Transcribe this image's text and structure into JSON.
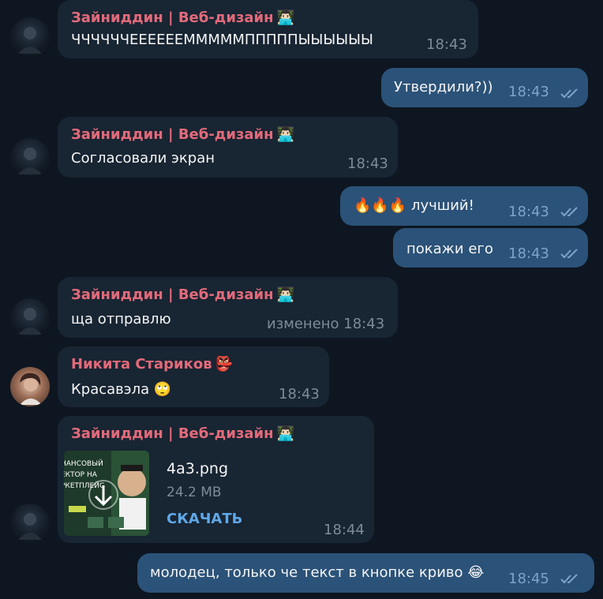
{
  "messages": [
    {
      "sender": "Зайниддин | Веб-дизайн",
      "sender_emoji": "👨🏻‍💻",
      "text": "ЧЧЧЧЧЧЕЕЕЕЕЕМММММПППППЫЫЫЫЫЫ",
      "time": "18:43"
    },
    {
      "text": "Утвердили?))",
      "time": "18:43"
    },
    {
      "sender": "Зайниддин | Веб-дизайн",
      "sender_emoji": "👨🏻‍💻",
      "text": "Согласовали экран",
      "time": "18:43"
    },
    {
      "text": "🔥🔥🔥 лучший!",
      "time": "18:43"
    },
    {
      "text": "покажи его",
      "time": "18:43"
    },
    {
      "sender": "Зайниддин | Веб-дизайн",
      "sender_emoji": "👨🏻‍💻",
      "text": "ща отправлю",
      "time": "изменено 18:43"
    },
    {
      "sender": "Никита Стариков",
      "sender_emoji": "👺",
      "text": "Красавэла 🙄",
      "time": "18:43"
    },
    {
      "sender": "Зайниддин | Веб-дизайн",
      "sender_emoji": "👨🏻‍💻",
      "file": {
        "name": "4a3.png",
        "size": "24.2 MB",
        "action": "СКАЧАТЬ",
        "thumb_text": "НАНСОВЫЙ ЕКТОР НА РКЕТПЛЕЙС"
      },
      "time": "18:44"
    },
    {
      "text": "молодец, только че текст в кнопке криво 😂",
      "time": "18:45"
    }
  ],
  "colors": {
    "background": "#0e1621",
    "incoming": "#182533",
    "outgoing": "#2b5278",
    "sender_name": "#e36a7a",
    "link": "#5fa8e8"
  },
  "icons": {
    "read_receipt": "double-check-icon",
    "download": "download-arrow-icon"
  }
}
